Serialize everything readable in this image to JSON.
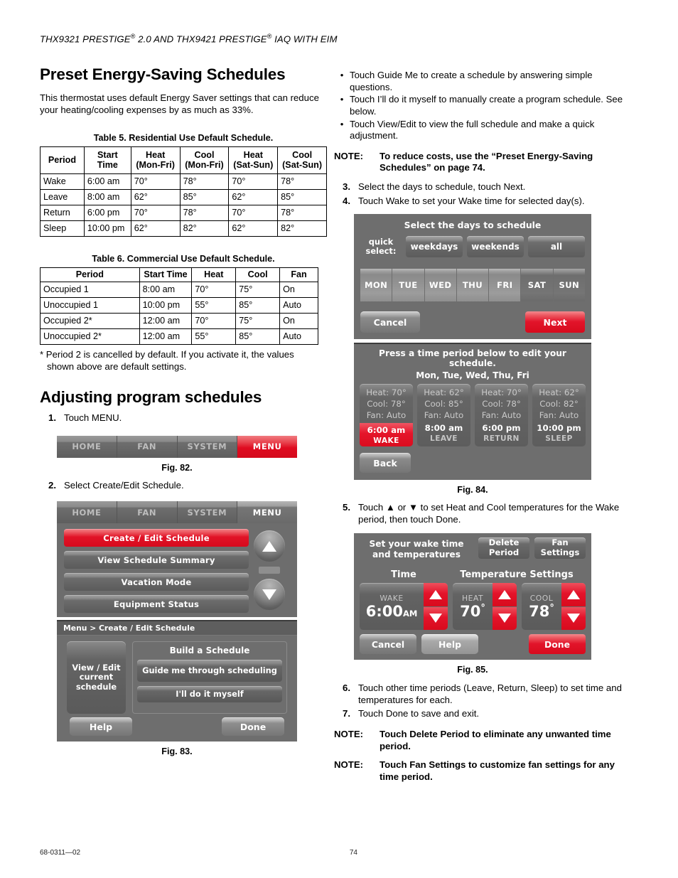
{
  "header": {
    "line": "THX9321 PRESTIGE® 2.0 AND THX9421 PRESTIGE® IAQ WITH EIM",
    "part1": "THX9321 PRESTIGE",
    "reg1": "®",
    "part2": " 2.0 AND THX9421 PRESTIGE",
    "reg2": "®",
    "part3": " IAQ WITH EIM"
  },
  "left": {
    "title": "Preset Energy-Saving Schedules",
    "intro": "This thermostat uses default Energy Saver settings that can reduce your heating/cooling expenses by as much as 33%.",
    "table5": {
      "caption": "Table 5. Residential Use Default Schedule.",
      "columns": [
        "Period",
        "Start Time",
        "Heat (Mon-Fri)",
        "Cool (Mon-Fri)",
        "Heat (Sat-Sun)",
        "Cool (Sat-Sun)"
      ],
      "columns_split": [
        {
          "l1": "",
          "l2": "Period"
        },
        {
          "l1": "Start",
          "l2": "Time"
        },
        {
          "l1": "Heat",
          "l2": "(Mon-Fri)"
        },
        {
          "l1": "Cool",
          "l2": "(Mon-Fri)"
        },
        {
          "l1": "Heat",
          "l2": "(Sat-Sun)"
        },
        {
          "l1": "Cool",
          "l2": "(Sat-Sun)"
        }
      ],
      "rows": [
        [
          "Wake",
          "6:00 am",
          "70°",
          "78°",
          "70°",
          "78°"
        ],
        [
          "Leave",
          "8:00 am",
          "62°",
          "85°",
          "62°",
          "85°"
        ],
        [
          "Return",
          "6:00 pm",
          "70°",
          "78°",
          "70°",
          "78°"
        ],
        [
          "Sleep",
          "10:00 pm",
          "62°",
          "82°",
          "62°",
          "82°"
        ]
      ]
    },
    "table6": {
      "caption": "Table 6. Commercial Use Default Schedule.",
      "columns": [
        "Period",
        "Start Time",
        "Heat",
        "Cool",
        "Fan"
      ],
      "rows": [
        [
          "Occupied 1",
          "8:00 am",
          "70°",
          "75°",
          "On"
        ],
        [
          "Unoccupied 1",
          "10:00 pm",
          "55°",
          "85°",
          "Auto"
        ],
        [
          "Occupied 2*",
          "12:00 am",
          "70°",
          "75°",
          "On"
        ],
        [
          "Unoccupied 2*",
          "12:00 am",
          "55°",
          "85°",
          "Auto"
        ]
      ]
    },
    "footnote_l1": "* Period 2 is cancelled by default. If you activate it, the values",
    "footnote_l2": "shown above are default settings.",
    "title2": "Adjusting program schedules",
    "step1_num": "1.",
    "step1_text": "Touch MENU.",
    "fig82_caption": "Fig. 82.",
    "step2_num": "2.",
    "step2_text": "Select Create/Edit Schedule.",
    "fig83_caption": "Fig. 83."
  },
  "right": {
    "bullets": [
      "Touch Guide Me to create a schedule by answering simple questions.",
      "Touch I’ll do it myself to manually create a program schedule. See below.",
      "Touch View/Edit to view the full schedule and make a quick adjustment."
    ],
    "note1_label": "NOTE:",
    "note1_text": "To reduce costs, use the “Preset Energy-Saving Schedules” on page 74.",
    "step3_num": "3.",
    "step3_text": "Select the days to schedule, touch Next.",
    "step4_num": "4.",
    "step4_text": "Touch Wake to set your Wake time for selected day(s).",
    "fig84_caption": "Fig. 84.",
    "step5_num": "5.",
    "step5_text": "Touch ▲ or ▼ to set Heat and Cool temperatures for the Wake period, then touch Done.",
    "fig85_caption": "Fig. 85.",
    "step6_num": "6.",
    "step6_text": "Touch other time periods (Leave, Return, Sleep) to set time and temperatures for each.",
    "step7_num": "7.",
    "step7_text": "Touch Done to save and exit.",
    "note2_label": "NOTE:",
    "note2_text": "Touch Delete Period to eliminate any unwanted time period.",
    "note3_label": "NOTE:",
    "note3_text": "Touch Fan Settings to customize fan settings for any time period."
  },
  "fig82": {
    "tabs": [
      {
        "label": "HOME",
        "state": "inactive"
      },
      {
        "label": "FAN",
        "state": "inactive"
      },
      {
        "label": "SYSTEM",
        "state": "inactive"
      },
      {
        "label": "MENU",
        "state": "active-red"
      }
    ]
  },
  "fig83": {
    "tabs": [
      {
        "label": "HOME",
        "state": "inactive"
      },
      {
        "label": "FAN",
        "state": "inactive"
      },
      {
        "label": "SYSTEM",
        "state": "inactive"
      },
      {
        "label": "MENU",
        "state": "active-grey"
      }
    ],
    "menu_items": [
      {
        "label": "Create / Edit Schedule",
        "selected": true
      },
      {
        "label": "View Schedule Summary",
        "selected": false
      },
      {
        "label": "Vacation Mode",
        "selected": false
      },
      {
        "label": "Equipment Status",
        "selected": false
      }
    ],
    "scroll_up_icon": "triangle-up-icon",
    "scroll_down_icon": "triangle-down-icon",
    "breadcrumb": "Menu > Create / Edit Schedule",
    "view_edit_label": "View / Edit current schedule",
    "build_title": "Build a Schedule",
    "guide_label": "Guide me through scheduling",
    "myself_label": "I'll do it myself",
    "help_label": "Help",
    "done_label": "Done"
  },
  "fig84": {
    "title": "Select the days to schedule",
    "quick_label": "quick select:",
    "quick_buttons": [
      "weekdays",
      "weekends",
      "all"
    ],
    "days": [
      {
        "label": "MON",
        "selected": true
      },
      {
        "label": "TUE",
        "selected": true
      },
      {
        "label": "WED",
        "selected": true
      },
      {
        "label": "THU",
        "selected": true
      },
      {
        "label": "FRI",
        "selected": true
      },
      {
        "label": "SAT",
        "selected": false
      },
      {
        "label": "SUN",
        "selected": false
      }
    ],
    "cancel_label": "Cancel",
    "next_label": "Next",
    "period_title": "Press a time period below to edit your schedule.",
    "period_days": "Mon, Tue, Wed, Thu, Fri",
    "periods": [
      {
        "heat": "Heat: 70°",
        "cool": "Cool: 78°",
        "fan": "Fan: Auto",
        "time": "6:00 am",
        "name": "WAKE",
        "active": true
      },
      {
        "heat": "Heat: 62°",
        "cool": "Cool: 85°",
        "fan": "Fan: Auto",
        "time": "8:00 am",
        "name": "LEAVE",
        "active": false
      },
      {
        "heat": "Heat: 70°",
        "cool": "Cool: 78°",
        "fan": "Fan: Auto",
        "time": "6:00 pm",
        "name": "RETURN",
        "active": false
      },
      {
        "heat": "Heat: 62°",
        "cool": "Cool: 82°",
        "fan": "Fan: Auto",
        "time": "10:00 pm",
        "name": "SLEEP",
        "active": false
      }
    ],
    "back_label": "Back"
  },
  "fig85": {
    "title": "Set your wake time and temperatures",
    "delete_period_label": "Delete Period",
    "fan_settings_label": "Fan Settings",
    "time_label": "Time",
    "temp_label": "Temperature Settings",
    "wake_cap": "WAKE",
    "wake_time": "6:00",
    "wake_ampm": "AM",
    "heat_cap": "HEAT",
    "heat_value": "70",
    "heat_deg": "°",
    "cool_cap": "COOL",
    "cool_value": "78",
    "cool_deg": "°",
    "cancel_label": "Cancel",
    "help_label": "Help",
    "done_label": "Done"
  },
  "footer": {
    "doc_number": "68-0311—02",
    "page_number": "74"
  },
  "colors": {
    "accent_red": "#e2142a",
    "screen_grey": "#6e6e6e",
    "button_grey": "#8c8c8c"
  }
}
